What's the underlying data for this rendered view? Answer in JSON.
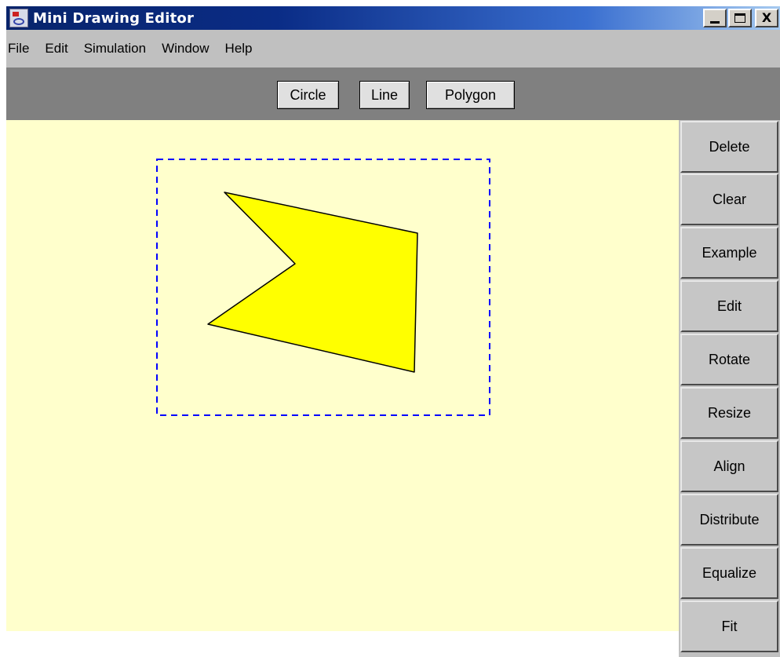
{
  "window": {
    "title": "Mini Drawing Editor",
    "controls": {
      "minimize": "_",
      "maximize": "□",
      "close": "X"
    }
  },
  "menubar": {
    "items": [
      "File",
      "Edit",
      "Simulation",
      "Window",
      "Help"
    ]
  },
  "toolbar": {
    "buttons": [
      "Circle",
      "Line",
      "Polygon"
    ]
  },
  "side_panel": {
    "buttons": [
      "Delete",
      "Clear",
      "Example",
      "Edit",
      "Rotate",
      "Resize",
      "Align",
      "Distribute",
      "Equalize",
      "Fit"
    ]
  },
  "canvas": {
    "background": "#ffffcc",
    "shapes": [
      {
        "type": "polygon",
        "fill": "#ffff00",
        "stroke": "#000000",
        "selected": true,
        "selection_color": "#0000ff"
      }
    ]
  },
  "colors": {
    "titlebar_start": "#08246b",
    "titlebar_end": "#a6caf0",
    "menubar": "#c0c0c0",
    "toolbar": "#808080",
    "button_face": "#c6c6c6"
  }
}
